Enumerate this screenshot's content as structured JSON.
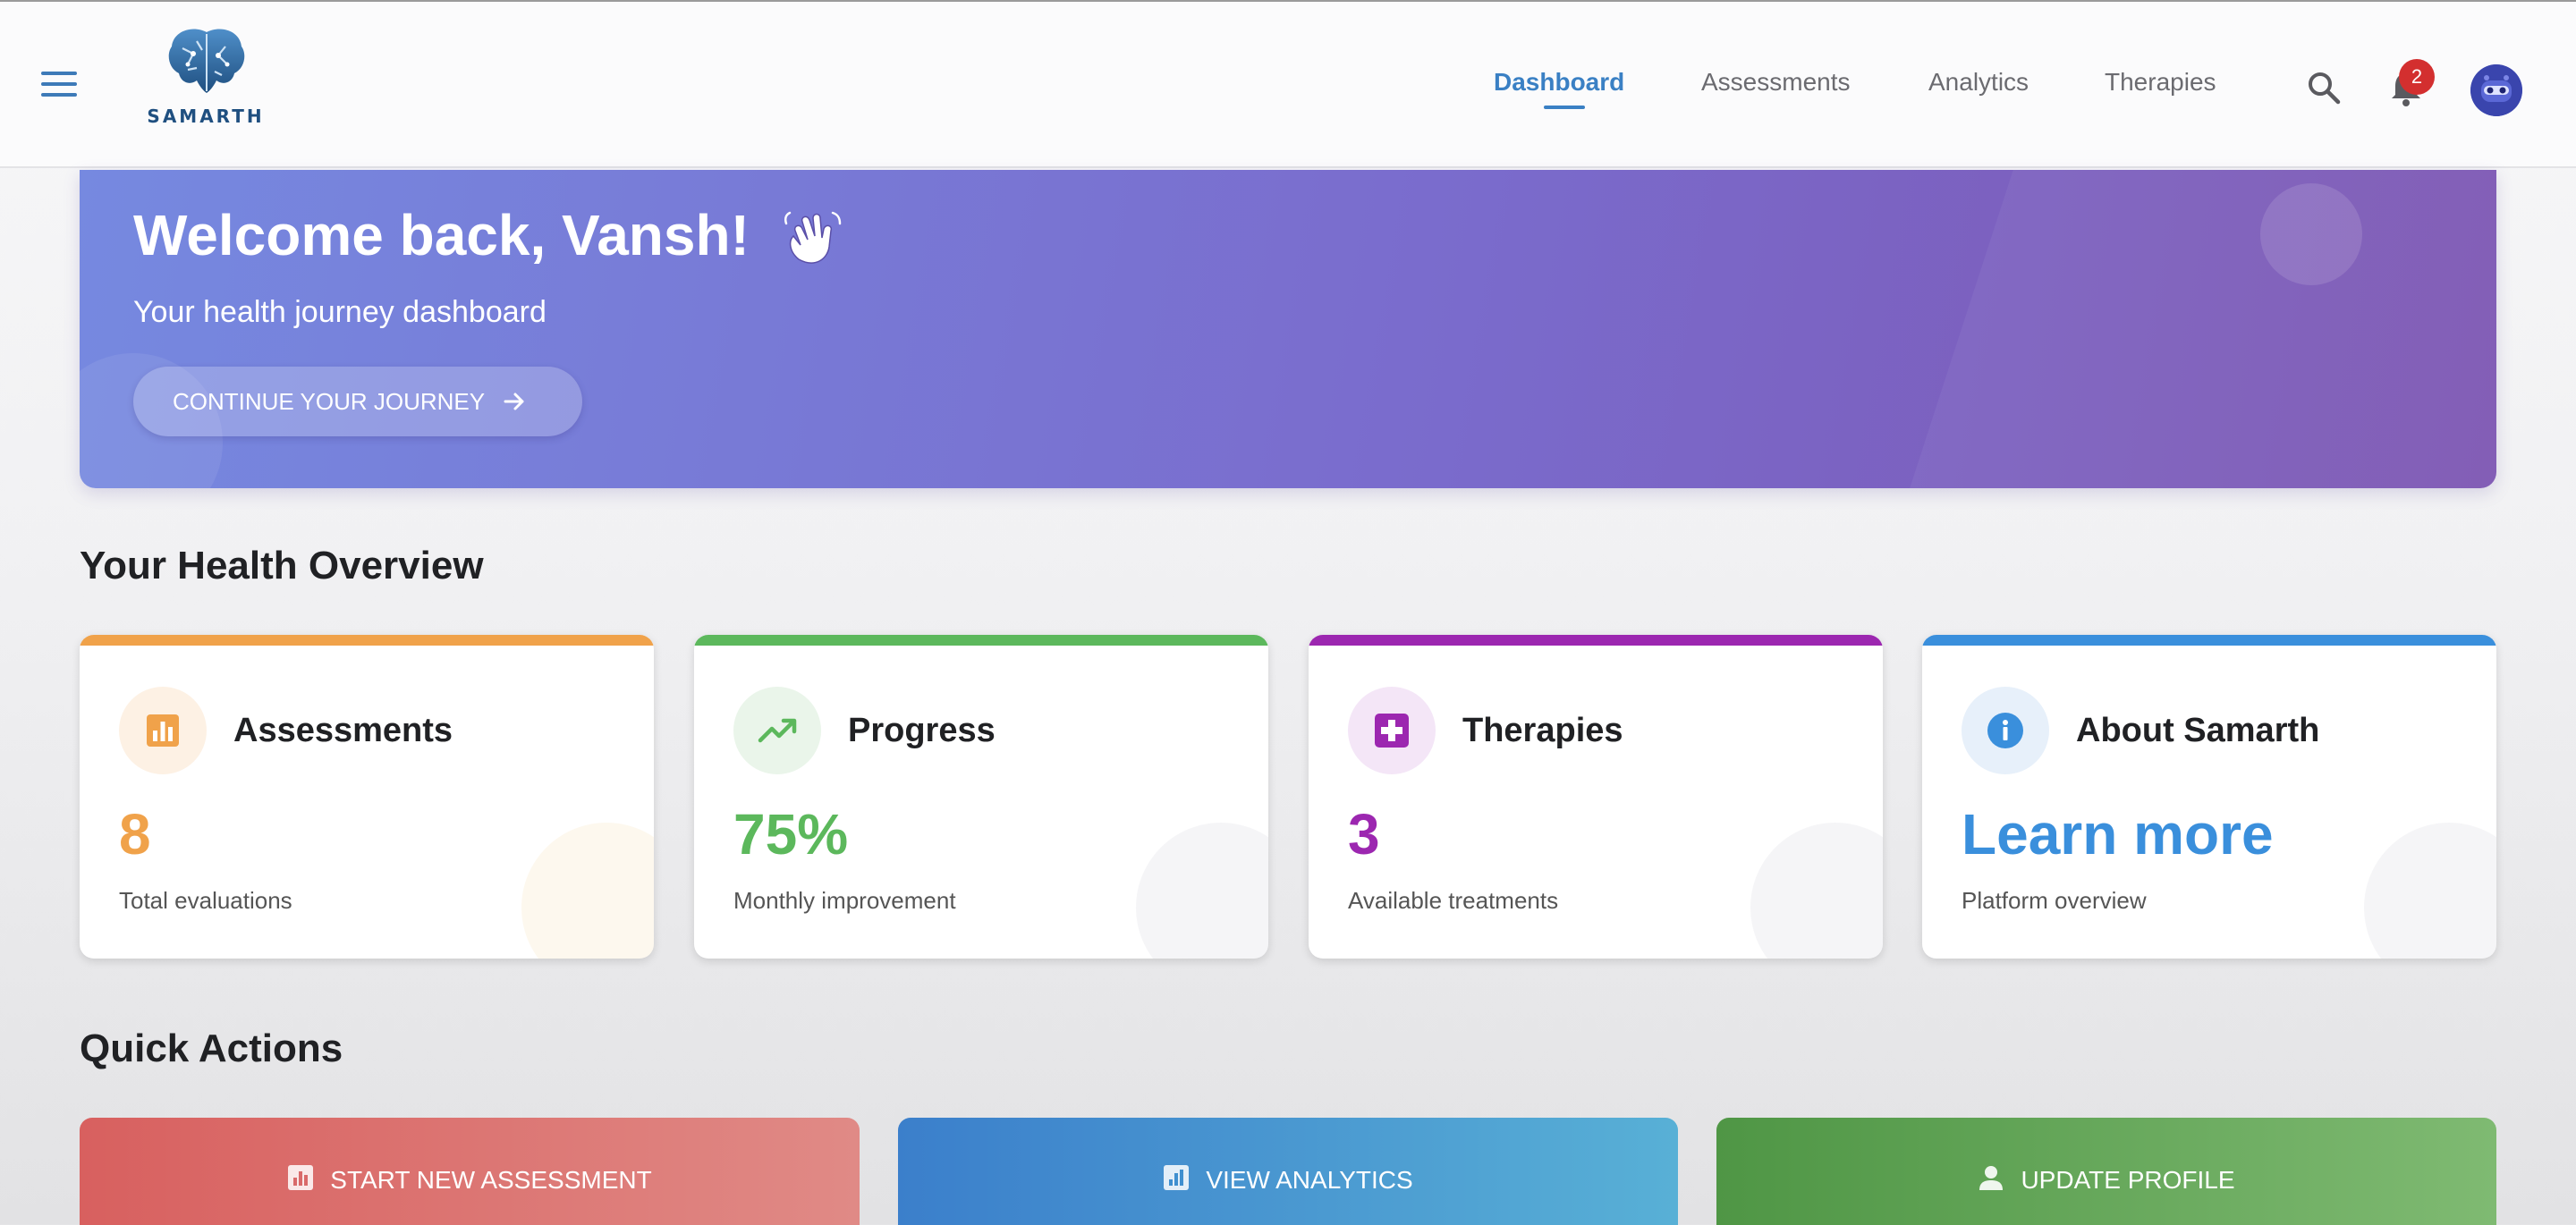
{
  "app": {
    "logo_text": "SAMARTH"
  },
  "nav": {
    "items": [
      {
        "label": "Dashboard",
        "active": true
      },
      {
        "label": "Assessments",
        "active": false
      },
      {
        "label": "Analytics",
        "active": false
      },
      {
        "label": "Therapies",
        "active": false
      }
    ],
    "notification_count": "2",
    "icons": [
      "menu-icon",
      "search-icon",
      "bell-icon",
      "avatar"
    ]
  },
  "banner": {
    "title": "Welcome back, Vansh!",
    "subtitle": "Your health journey dashboard",
    "button_label": "CONTINUE YOUR JOURNEY",
    "icons": [
      "waving-hand-icon",
      "arrow-right-icon"
    ]
  },
  "overview": {
    "title": "Your Health Overview",
    "cards": [
      {
        "title": "Assessments",
        "value": "8",
        "description": "Total evaluations",
        "color": "#f0a24a",
        "icon": "bar-chart-icon"
      },
      {
        "title": "Progress",
        "value": "75%",
        "description": "Monthly improvement",
        "color": "#5cb85c",
        "icon": "trending-up-icon"
      },
      {
        "title": "Therapies",
        "value": "3",
        "description": "Available treatments",
        "color": "#9c27b0",
        "icon": "medical-cross-icon"
      },
      {
        "title": "About Samarth",
        "value": "Learn more",
        "description": "Platform overview",
        "color": "#3a8fdc",
        "icon": "info-icon"
      }
    ]
  },
  "quick_actions": {
    "title": "Quick Actions",
    "items": [
      {
        "label": "START NEW ASSESSMENT",
        "color": "#d96a6a",
        "icon": "bar-chart-icon"
      },
      {
        "label": "VIEW ANALYTICS",
        "color": "#3f8fcf",
        "icon": "analytics-icon"
      },
      {
        "label": "UPDATE PROFILE",
        "color": "#5a9e4f",
        "icon": "person-icon"
      }
    ]
  }
}
